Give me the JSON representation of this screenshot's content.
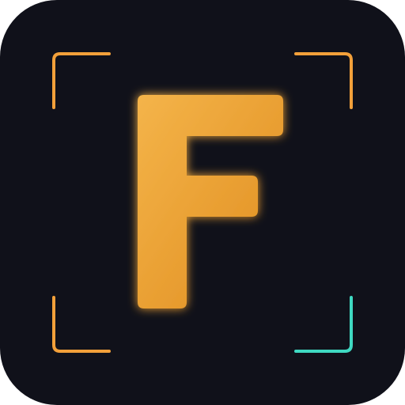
{
  "app_icon": {
    "letter": "F",
    "colors": {
      "tile_background": "#10111a",
      "letter_gradient_start": "#f4b44a",
      "letter_gradient_end": "#e08d1e",
      "bracket_orange": "#f2a03a",
      "bracket_teal": "#3fd9c2",
      "letter_glow": "#f2a23a"
    },
    "icons": {
      "frame": "viewfinder-corners-icon",
      "letter": "letter-f-glyph"
    }
  }
}
